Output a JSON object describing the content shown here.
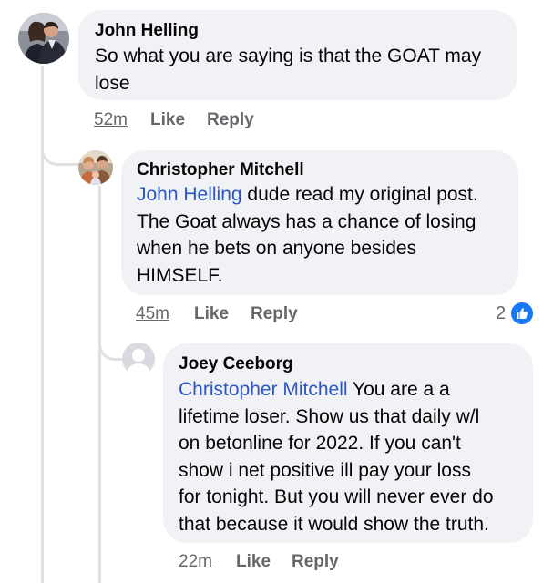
{
  "comments": [
    {
      "author": "John Helling",
      "text_line1": "So what you are saying is that the GOAT may",
      "text_line2": "lose",
      "time": "52m",
      "like_label": "Like",
      "reply_label": "Reply"
    },
    {
      "author": "Christopher Mitchell",
      "mention": "John Helling",
      "text_line1": " dude read my original post.",
      "text_line2": "The Goat always has a chance of losing",
      "text_line3": "when he bets on anyone besides",
      "text_line4": "HIMSELF.",
      "time": "45m",
      "like_label": "Like",
      "reply_label": "Reply",
      "reaction_count": "2"
    },
    {
      "author": "Joey Ceeborg",
      "mention": "Christopher Mitchell",
      "text_line1": " You are a a",
      "text_line2": "lifetime loser. Show us that daily w/l",
      "text_line3": "on betonline for 2022. If you can't",
      "text_line4": "show i net positive ill pay your loss",
      "text_line5": "for tonight. But you will never ever do",
      "text_line6": "that because it would show the truth.",
      "time": "22m",
      "like_label": "Like",
      "reply_label": "Reply"
    }
  ],
  "colors": {
    "bubble": "#f0f2f5",
    "mention": "#2a56c6",
    "meta": "#65676b",
    "like_badge": "#1877f2",
    "thread_line": "#dfe1e5"
  },
  "icons": {
    "reaction": "thumbs-up-icon",
    "default_avatar": "person-silhouette-icon"
  }
}
